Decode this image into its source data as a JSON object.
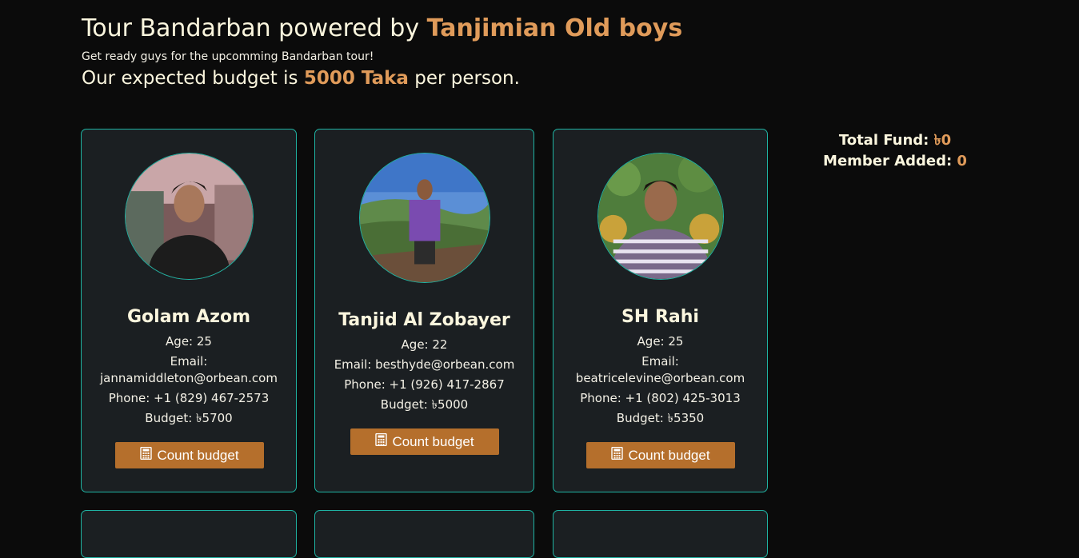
{
  "header": {
    "title_prefix": "Tour Bandarban powered by ",
    "title_accent": "Tanjimian Old boys",
    "subtitle": "Get ready guys for the upcomming Bandarban tour!",
    "budget_prefix": "Our expected budget is ",
    "budget_amount": "5000 Taka",
    "budget_suffix": " per person."
  },
  "summary": {
    "fund_label": "Total Fund: ",
    "fund_value": "৳0",
    "member_label": "Member Added: ",
    "member_value": "0"
  },
  "members": [
    {
      "name": "Golam Azom",
      "age": "Age: 25",
      "email_label": "Email:",
      "email": "jannamiddleton@orbean.com",
      "phone": "Phone: +1 (829) 467-2573",
      "budget": "Budget: ৳5700",
      "button_label": "Count budget"
    },
    {
      "name": "Tanjid Al Zobayer",
      "age": "Age: 22",
      "email_line": "Email: besthyde@orbean.com",
      "phone": "Phone: +1 (926) 417-2867",
      "budget": "Budget: ৳5000",
      "button_label": "Count budget"
    },
    {
      "name": "SH Rahi",
      "age": "Age: 25",
      "email_label": "Email:",
      "email": "beatricelevine@orbean.com",
      "phone": "Phone: +1 (802) 425-3013",
      "budget": "Budget: ৳5350",
      "button_label": "Count budget"
    }
  ],
  "colors": {
    "accent": "#e09b5a",
    "card_border": "#1fb3a3",
    "card_bg": "#1b1f22",
    "button_bg": "#b56f2c",
    "page_bg": "#0b0b0b"
  },
  "icons": {
    "button_icon": "calculator-icon"
  }
}
